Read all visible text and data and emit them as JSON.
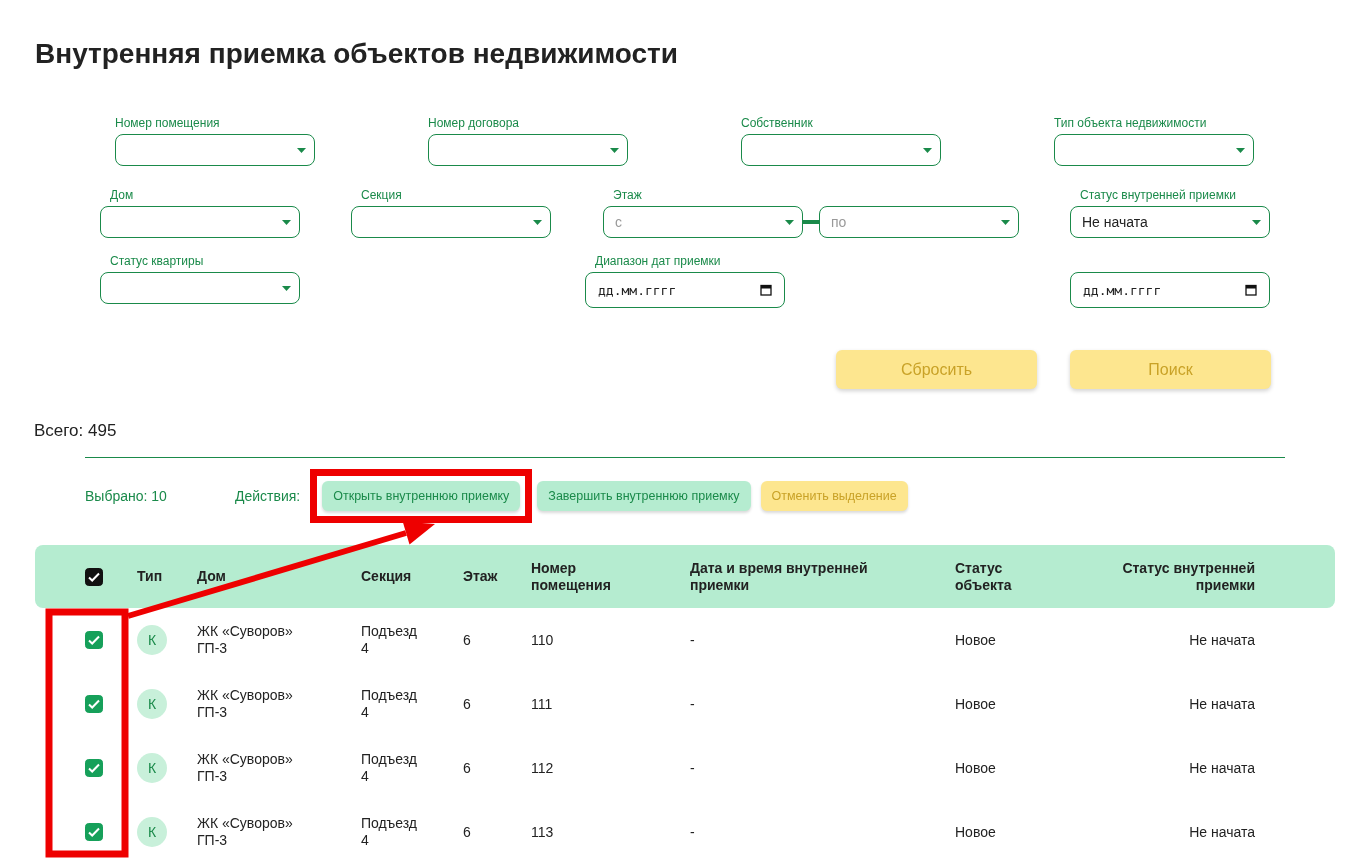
{
  "title": "Внутренняя приемка объектов недвижимости",
  "filter_rows": [
    {
      "fields": [
        {
          "kind": "select",
          "label": "Номер помещения"
        },
        {
          "kind": "select",
          "label": "Номер договора"
        },
        {
          "kind": "select",
          "label": "Собственник"
        },
        {
          "kind": "select",
          "label": "Тип объекта недвижимости"
        }
      ]
    },
    {
      "fields": [
        {
          "kind": "select",
          "label": "Дом"
        },
        {
          "kind": "select",
          "label": "Секция"
        },
        {
          "kind": "range",
          "label": "Этаж",
          "from_placeholder": "с",
          "to_placeholder": "по"
        },
        {
          "kind": "select",
          "label": "Статус внутренней приемки",
          "value": "Не начата"
        }
      ]
    },
    {
      "fields": [
        {
          "kind": "select",
          "label": "Статус квартиры"
        },
        {
          "kind": "date",
          "label": "Диапазон дат приемки",
          "placeholder": "дд.мм.гггг"
        },
        {
          "kind": "date",
          "placeholder": "дд.мм.гггг"
        }
      ]
    }
  ],
  "filter_buttons": [
    "Сбросить",
    "Поиск"
  ],
  "total": "Всего: 495",
  "selected_count": "Выбрано: 10",
  "actions_label": "Действия:",
  "actions": [
    {
      "kind": "green",
      "label": "Открыть внутреннюю приемку"
    },
    {
      "kind": "green",
      "label": "Завершить внутреннюю приемку"
    },
    {
      "kind": "yellow",
      "label": "Отменить выделение"
    }
  ],
  "table": {
    "all_checked": true,
    "columns": [
      "Тип",
      "Дом",
      "Секция",
      "Этаж",
      "Номер помещения",
      "Дата и время внутренней приемки",
      "Статус объекта",
      "Статус внутренней приемки"
    ],
    "rows": [
      {
        "checked": true,
        "cells": [
          "К",
          "ЖК «Суворов» ГП-3",
          "Подъезд 4",
          "6",
          "110",
          "-",
          "Новое",
          "Не начата"
        ]
      },
      {
        "checked": true,
        "cells": [
          "К",
          "ЖК «Суворов» ГП-3",
          "Подъезд 4",
          "6",
          "111",
          "-",
          "Новое",
          "Не начата"
        ]
      },
      {
        "checked": true,
        "cells": [
          "К",
          "ЖК «Суворов» ГП-3",
          "Подъезд 4",
          "6",
          "112",
          "-",
          "Новое",
          "Не начата"
        ]
      },
      {
        "checked": true,
        "cells": [
          "К",
          "ЖК «Суворов» ГП-3",
          "Подъезд 4",
          "6",
          "113",
          "-",
          "Новое",
          "Не начата"
        ]
      }
    ]
  }
}
